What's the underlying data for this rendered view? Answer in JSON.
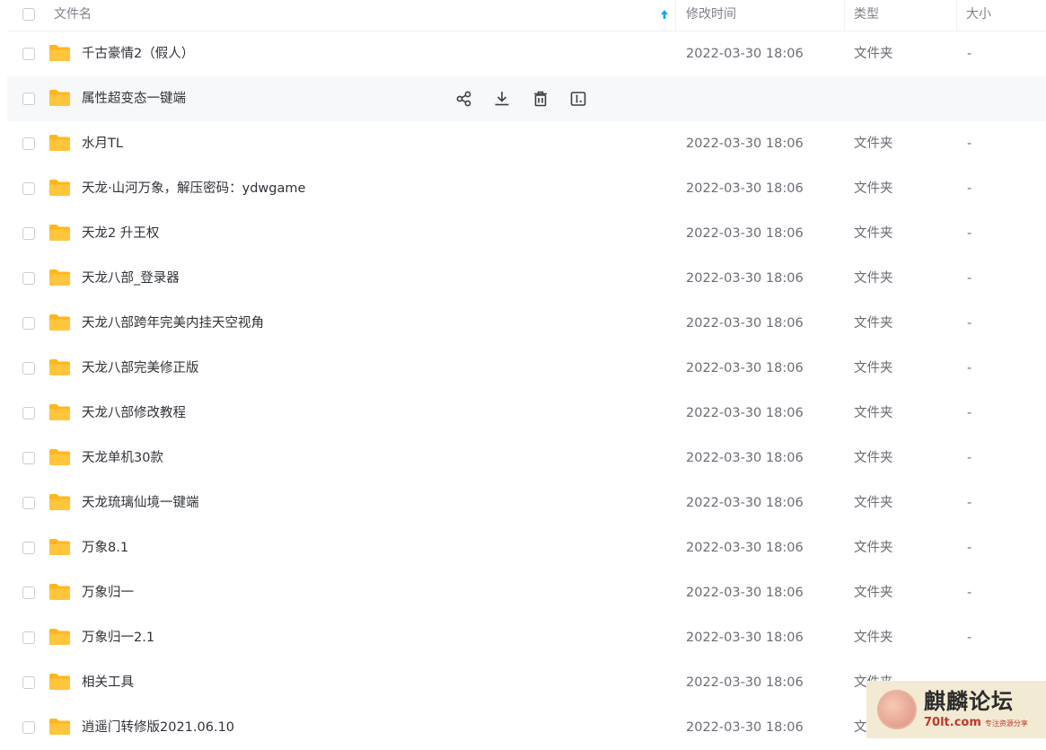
{
  "columns": {
    "name": "文件名",
    "modified": "修改时间",
    "type": "类型",
    "size": "大小"
  },
  "hover_row_index": 1,
  "actions": [
    "share-icon",
    "download-icon",
    "delete-icon",
    "rename-icon"
  ],
  "rows": [
    {
      "name": "千古豪情2（假人）",
      "date": "2022-03-30 18:06",
      "type": "文件夹",
      "size": "-"
    },
    {
      "name": "属性超变态一键端",
      "date": "",
      "type": "",
      "size": ""
    },
    {
      "name": "水月TL",
      "date": "2022-03-30 18:06",
      "type": "文件夹",
      "size": "-"
    },
    {
      "name": "天龙·山河万象，解压密码：ydwgame",
      "date": "2022-03-30 18:06",
      "type": "文件夹",
      "size": "-"
    },
    {
      "name": "天龙2  升王权",
      "date": "2022-03-30 18:06",
      "type": "文件夹",
      "size": "-"
    },
    {
      "name": "天龙八部_登录器",
      "date": "2022-03-30 18:06",
      "type": "文件夹",
      "size": "-"
    },
    {
      "name": "天龙八部跨年完美内挂天空视角",
      "date": "2022-03-30 18:06",
      "type": "文件夹",
      "size": "-"
    },
    {
      "name": "天龙八部完美修正版",
      "date": "2022-03-30 18:06",
      "type": "文件夹",
      "size": "-"
    },
    {
      "name": "天龙八部修改教程",
      "date": "2022-03-30 18:06",
      "type": "文件夹",
      "size": "-"
    },
    {
      "name": "天龙单机30款",
      "date": "2022-03-30 18:06",
      "type": "文件夹",
      "size": "-"
    },
    {
      "name": "天龙琉璃仙境一键端",
      "date": "2022-03-30 18:06",
      "type": "文件夹",
      "size": "-"
    },
    {
      "name": "万象8.1",
      "date": "2022-03-30 18:06",
      "type": "文件夹",
      "size": "-"
    },
    {
      "name": "万象归一",
      "date": "2022-03-30 18:06",
      "type": "文件夹",
      "size": "-"
    },
    {
      "name": "万象归一2.1",
      "date": "2022-03-30 18:06",
      "type": "文件夹",
      "size": "-"
    },
    {
      "name": "相关工具",
      "date": "2022-03-30 18:06",
      "type": "文件夹",
      "size": ""
    },
    {
      "name": "逍遥门转修版2021.06.10",
      "date": "2022-03-30 18:06",
      "type": "文",
      "size": ""
    }
  ],
  "watermark": {
    "title": "麒麟论坛",
    "url": "70lt.com",
    "tag": "专注资源分享"
  },
  "colors": {
    "folder": "#ffc53d",
    "folder_tab": "#ffb61e",
    "sort_arrow": "#06a7ff",
    "hover_bg": "#f7f8fa"
  }
}
